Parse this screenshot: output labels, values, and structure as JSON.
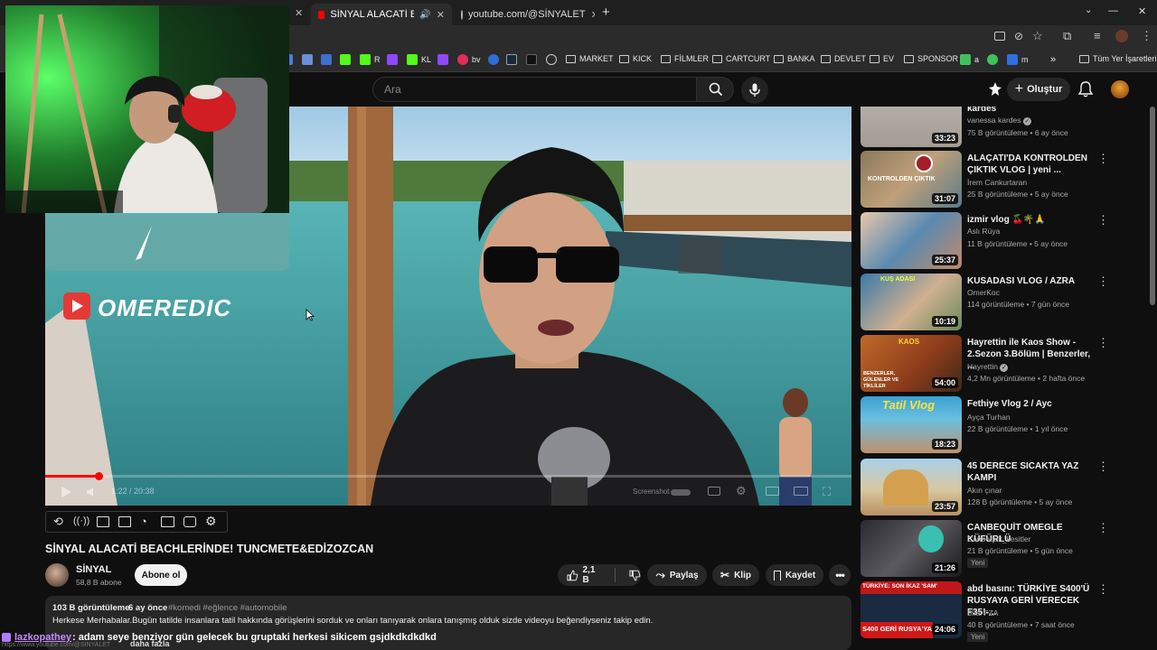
{
  "browser": {
    "tabs": [
      {
        "label": "SİNYAL ALACATİ BEACHLERİ"
      },
      {
        "label": "youtube.com/@SİNYALET"
      }
    ],
    "bookmarks": [
      "MARKET",
      "KICK",
      "FİLMLER",
      "CARTCURT",
      "BANKA",
      "DEVLET",
      "EV",
      "SPONSOR",
      "Tüm Yer İşaretleri"
    ],
    "bookmark_small": [
      "R",
      "KL",
      "bv",
      "a",
      "m"
    ]
  },
  "header": {
    "search_placeholder": "Ara",
    "create_label": "Oluştur"
  },
  "overlay": {
    "channel_tag": "OMEREDIC"
  },
  "player": {
    "time": "1:22 / 20:38",
    "screenshot_label": "Screenshot",
    "progress": 0.066
  },
  "video": {
    "title": "SİNYAL ALACATİ BEACHLERİNDE! TUNCMETE&EDİZOZCAN",
    "channel": "SİNYAL",
    "subscribers": "58,8 B abone",
    "subscribe_label": "Abone ol",
    "likes": "2,1 B",
    "share_label": "Paylaş",
    "clip_label": "Klip",
    "save_label": "Kaydet",
    "views": "103 B görüntüleme",
    "age": "6 ay önce",
    "tags": "#komedi #eğlence #automobile",
    "description": "Herkese Merhabalar.Bugün tatilde insanlara tatil hakkında görüşlerini sorduk ve onları tanıyarak onlara tanışmış olduk sizde videoyu beğendiyseniz takip edin.",
    "more_label": "daha fazla"
  },
  "chat": {
    "user": "lazkopathey",
    "message": ": adam seye benziyor gün gelecek bu gruptaki herkesi sikicem gsjdkdkdkdkd",
    "url": "https://www.youtube.com/@SİNYALET"
  },
  "recommendations": [
    {
      "title": "kardes",
      "channel": "vanessa kardes",
      "views": "75 B görüntüleme",
      "age": "6 ay önce",
      "duration": "33:23",
      "verified": true
    },
    {
      "title": "ALAÇATI'DA KONTROLDEN ÇIKTIK VLOG | yeni ...",
      "channel": "İrem Cankurtaran",
      "views": "25 B görüntüleme",
      "age": "5 ay önce",
      "duration": "31:07"
    },
    {
      "title": "izmir vlog 🍒🌴🙏",
      "channel": "Aslı Rüya",
      "views": "11 B görüntüleme",
      "age": "5 ay önce",
      "duration": "25:37"
    },
    {
      "title": "KUSADASI VLOG / AZRA",
      "channel": "OmerKoc",
      "views": "114 görüntüleme",
      "age": "7 gün önce",
      "duration": "10:19"
    },
    {
      "title": "Hayrettin ile Kaos Show - 2.Sezon 3.Bölüm | Benzerler, ...",
      "channel": "Hayrettin",
      "views": "4,2 Mn görüntüleme",
      "age": "2 hafta önce",
      "duration": "54:00",
      "verified": true
    },
    {
      "title": "Fethiye Vlog 2 / Ayc",
      "channel": "Ayça Turhan",
      "views": "22 B görüntüleme",
      "age": "1 yıl önce",
      "duration": "18:23"
    },
    {
      "title": "45 DERECE SICAKTA YAZ KAMPI",
      "channel": "Akın çınar",
      "views": "128 B görüntüleme",
      "age": "5 ay önce",
      "duration": "23:57"
    },
    {
      "title": "CANBEQUİT OMEGLE KÜFÜRLÜ",
      "channel": "Canbequit_kesitler",
      "views": "21 B görüntüleme",
      "age": "5 gün önce",
      "duration": "21:26",
      "badge": "Yeni"
    },
    {
      "title": "abd basını: TÜRKİYE S400'Ü RUSYAYA GERİ VERECEK F35!-...",
      "channel": "Bilal FZA",
      "views": "40 B görüntüleme",
      "age": "7 saat önce",
      "duration": "24:06",
      "badge": "Yeni"
    }
  ],
  "thumb_text": {
    "r1": "KONTROLDEN ÇIKTIK",
    "r3": "KUŞ ADASI",
    "r4": "BENZERLER, GÜLENLER VE TİKLİLER",
    "r4b": "KAOS",
    "r5": "Tatil Vlog",
    "r8a": "TÜRKİYE: SON İKAZ 'SAM'",
    "r8b": "S400 GERİ RUSYA'YA"
  },
  "colors": {
    "accent": "#ff0000",
    "bg": "#0f0f0f",
    "pill": "#272727"
  }
}
